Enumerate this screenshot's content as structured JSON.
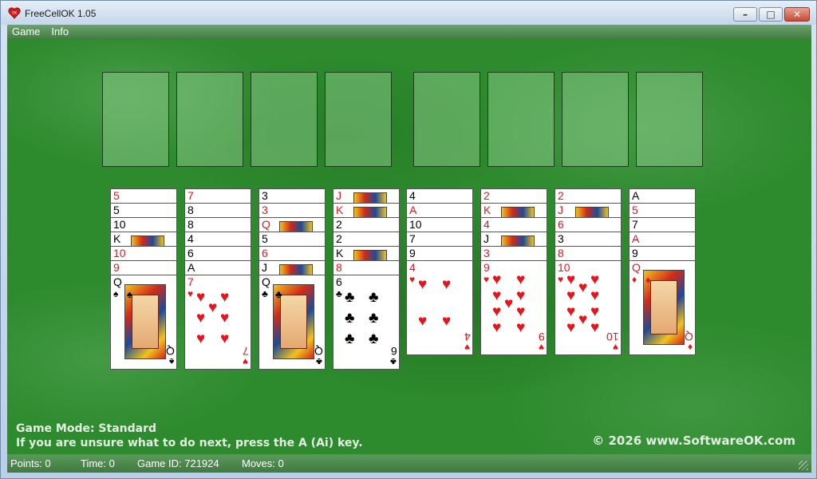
{
  "window": {
    "title": "FreeCellOK 1.05",
    "controls": {
      "minimize": "–",
      "maximize": "□",
      "close": "✕"
    }
  },
  "menu": {
    "items": [
      "Game",
      "Info"
    ]
  },
  "free_cells": 4,
  "foundations": 4,
  "tableau": [
    {
      "peek": [
        [
          "5",
          "red"
        ],
        [
          "5",
          "black"
        ],
        [
          "10",
          "black"
        ],
        [
          "K",
          "black"
        ],
        [
          "10",
          "red"
        ],
        [
          "9",
          "red"
        ]
      ],
      "top": {
        "rank": "Q",
        "suit": "♠",
        "color": "black",
        "face": true
      }
    },
    {
      "peek": [
        [
          "7",
          "red"
        ],
        [
          "8",
          "black"
        ],
        [
          "8",
          "black"
        ],
        [
          "4",
          "black"
        ],
        [
          "6",
          "black"
        ],
        [
          "A",
          "black"
        ]
      ],
      "top": {
        "rank": "7",
        "suit": "♥",
        "color": "red",
        "pips": 7
      }
    },
    {
      "peek": [
        [
          "3",
          "black"
        ],
        [
          "3",
          "red"
        ],
        [
          "Q",
          "red"
        ],
        [
          "5",
          "black"
        ],
        [
          "6",
          "red"
        ],
        [
          "J",
          "black"
        ]
      ],
      "top": {
        "rank": "Q",
        "suit": "♣",
        "color": "black",
        "face": true
      }
    },
    {
      "peek": [
        [
          "J",
          "red"
        ],
        [
          "K",
          "red"
        ],
        [
          "2",
          "black"
        ],
        [
          "2",
          "black"
        ],
        [
          "K",
          "black"
        ],
        [
          "8",
          "red"
        ]
      ],
      "top": {
        "rank": "6",
        "suit": "♣",
        "color": "black",
        "pips": 6
      }
    },
    {
      "peek": [
        [
          "4",
          "black"
        ],
        [
          "A",
          "red"
        ],
        [
          "10",
          "black"
        ],
        [
          "7",
          "black"
        ],
        [
          "9",
          "black"
        ]
      ],
      "top": {
        "rank": "4",
        "suit": "♥",
        "color": "red",
        "pips": 4
      }
    },
    {
      "peek": [
        [
          "2",
          "red"
        ],
        [
          "K",
          "red"
        ],
        [
          "4",
          "red"
        ],
        [
          "J",
          "black"
        ],
        [
          "3",
          "red"
        ]
      ],
      "top": {
        "rank": "9",
        "suit": "♥",
        "color": "red",
        "pips": 9
      }
    },
    {
      "peek": [
        [
          "2",
          "red"
        ],
        [
          "J",
          "red"
        ],
        [
          "6",
          "red"
        ],
        [
          "3",
          "black"
        ],
        [
          "8",
          "red"
        ]
      ],
      "top": {
        "rank": "10",
        "suit": "♥",
        "color": "red",
        "pips": 10
      }
    },
    {
      "peek": [
        [
          "A",
          "black"
        ],
        [
          "5",
          "red"
        ],
        [
          "7",
          "black"
        ],
        [
          "A",
          "red"
        ],
        [
          "9",
          "black"
        ]
      ],
      "top": {
        "rank": "Q",
        "suit": "♦",
        "color": "red",
        "face": true
      }
    }
  ],
  "info": {
    "mode": "Game Mode: Standard",
    "hint": "If you are unsure what to do next, press the A (Ai) key.",
    "copyright": "© 2026 www.SoftwareOK.com"
  },
  "status": {
    "points": "Points:  0",
    "time": "Time:  0",
    "game_id": "Game ID: 721924",
    "moves": "Moves: 0"
  }
}
